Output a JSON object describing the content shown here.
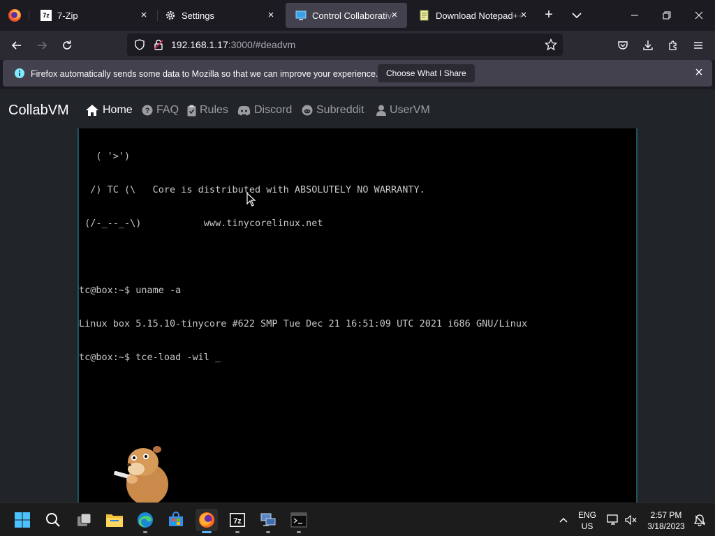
{
  "browser": {
    "tabs": [
      {
        "title": "7-Zip",
        "icon": "7zip-icon"
      },
      {
        "title": "Settings",
        "icon": "gear-icon"
      },
      {
        "title": "Control Collaborative V",
        "icon": "monitor-icon",
        "active": true
      },
      {
        "title": "Download Notepad++",
        "icon": "notepad-icon"
      }
    ],
    "url_host": "192.168.1.17",
    "url_rest": ":3000/#deadvm",
    "notification": {
      "text": "Firefox automatically sends some data to Mozilla so that we can improve your experience.",
      "button": "Choose What I Share"
    }
  },
  "site": {
    "brand": "CollabVM",
    "nav": [
      {
        "label": "Home",
        "icon": "home-icon",
        "active": true
      },
      {
        "label": "FAQ",
        "icon": "question-icon"
      },
      {
        "label": "Rules",
        "icon": "clipboard-check-icon"
      },
      {
        "label": "Discord",
        "icon": "discord-icon"
      },
      {
        "label": "Subreddit",
        "icon": "reddit-icon"
      },
      {
        "label": "UserVM",
        "icon": "user-icon"
      }
    ]
  },
  "terminal": {
    "lines": [
      "   ( '>')",
      "  /) TC (\\   Core is distributed with ABSOLUTELY NO WARRANTY.",
      " (/-_--_-\\)           www.tinycorelinux.net",
      "",
      "tc@box:~$ uname -a",
      "Linux box 5.15.10-tinycore #622 SMP Tue Dec 21 16:51:09 UTC 2021 i686 GNU/Linux",
      "tc@box:~$ tce-load -wil _"
    ]
  },
  "taskbar": {
    "lang_line1": "ENG",
    "lang_line2": "US",
    "time": "2:57 PM",
    "date": "3/18/2023",
    "apps": [
      "windows-start-icon",
      "search-icon",
      "task-view-icon",
      "file-explorer-icon",
      "edge-icon",
      "store-icon",
      "firefox-icon",
      "7zip-icon",
      "network-app-icon",
      "terminal-icon"
    ]
  },
  "colors": {
    "browser_bg": "#1c1b22",
    "toolbar_bg": "#2b2a33",
    "page_bg": "#212529",
    "vm_bg": "#000000",
    "taskbar_bg": "#1c1c1c"
  }
}
